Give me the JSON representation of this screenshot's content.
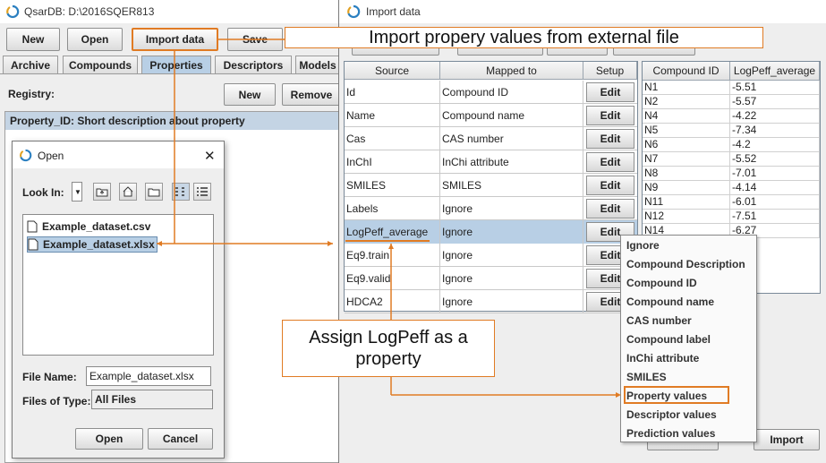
{
  "main_window": {
    "title": "QsarDB: D:\\2016SQER813",
    "toolbar": {
      "new": "New",
      "open": "Open",
      "import": "Import data",
      "save": "Save"
    },
    "tabs": [
      "Archive",
      "Compounds",
      "Properties",
      "Descriptors",
      "Models"
    ],
    "registry_label": "Registry:",
    "registry_new": "New",
    "registry_remove": "Remove",
    "property_row": "Property_ID: Short description about property"
  },
  "open_dialog": {
    "title": "Open",
    "close_glyph": "✕",
    "look_in_label": "Look In:",
    "files": [
      "Example_dataset.csv",
      "Example_dataset.xlsx"
    ],
    "file_name_label": "File Name:",
    "file_name_value": "Example_dataset.xlsx",
    "files_type_label": "Files of Type:",
    "files_type_value": "All Files",
    "open_button": "Open",
    "cancel_button": "Cancel"
  },
  "import_dialog": {
    "title": "Import data",
    "headers": {
      "source": "Source",
      "mapped": "Mapped to",
      "setup": "Setup"
    },
    "rows": [
      {
        "source": "Id",
        "mapped": "Compound ID",
        "setup": "Edit"
      },
      {
        "source": "Name",
        "mapped": "Compound name",
        "setup": "Edit"
      },
      {
        "source": "Cas",
        "mapped": "CAS number",
        "setup": "Edit"
      },
      {
        "source": "InChI",
        "mapped": "InChi attribute",
        "setup": "Edit"
      },
      {
        "source": "SMILES",
        "mapped": "SMILES",
        "setup": "Edit"
      },
      {
        "source": "Labels",
        "mapped": "Ignore",
        "setup": "Edit"
      },
      {
        "source": "LogPeff_average",
        "mapped": "Ignore",
        "setup": "Edit"
      },
      {
        "source": "Eq9.train",
        "mapped": "Ignore",
        "setup": "Edit"
      },
      {
        "source": "Eq9.valid",
        "mapped": "Ignore",
        "setup": "Edit"
      },
      {
        "source": "HDCA2",
        "mapped": "Ignore",
        "setup": "Edit"
      }
    ],
    "preview_headers": {
      "id": "Compound ID",
      "value": "LogPeff_average"
    },
    "preview_rows": [
      {
        "id": "N1",
        "value": "-5.51"
      },
      {
        "id": "N2",
        "value": "-5.57"
      },
      {
        "id": "N4",
        "value": "-4.22"
      },
      {
        "id": "N5",
        "value": "-7.34"
      },
      {
        "id": "N6",
        "value": "-4.2"
      },
      {
        "id": "N7",
        "value": "-5.52"
      },
      {
        "id": "N8",
        "value": "-7.01"
      },
      {
        "id": "N9",
        "value": "-4.14"
      },
      {
        "id": "N11",
        "value": "-6.01"
      },
      {
        "id": "N12",
        "value": "-7.51"
      },
      {
        "id": "N14",
        "value": "-6.27"
      }
    ],
    "import_button": "Import"
  },
  "context_menu": {
    "items": [
      "Ignore",
      "Compound Description",
      "Compound ID",
      "Compound name",
      "CAS number",
      "Compound label",
      "InChi attribute",
      "SMILES",
      "Property values",
      "Descriptor values",
      "Prediction values"
    ]
  },
  "annotations": {
    "top": "Import propery values from external file",
    "middle": "Assign LogPeff as a property"
  },
  "colors": {
    "accent": "#e07b24",
    "selection": "#b8cfe5",
    "header": "#c4d4e4"
  }
}
